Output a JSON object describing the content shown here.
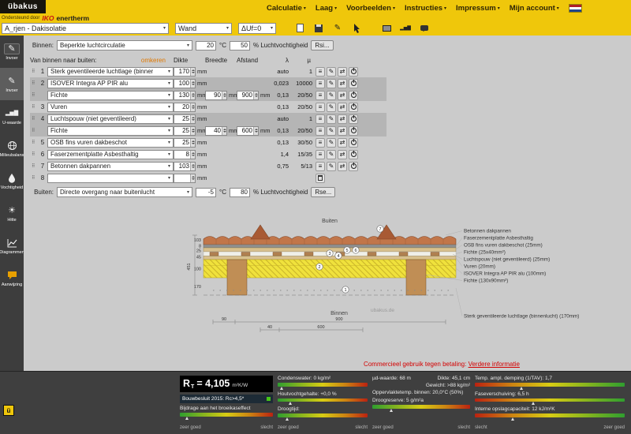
{
  "topbar": {
    "logo": "übakus",
    "supported_by": "Ondersteund door",
    "iko": "IKO",
    "enertherm": "enertherm",
    "menu": [
      "Calculatie",
      "Laag",
      "Voorbeelden",
      "Instructies",
      "Impressum",
      "Mijn account"
    ]
  },
  "toolbar": {
    "project": "A_rjen - Dakisolatie",
    "type": "Wand",
    "du": "ΔUf=0"
  },
  "icons": {
    "caret": "▾",
    "drag": "⠿",
    "menu": "≡",
    "edit": "✎",
    "swap": "⇄",
    "pencil": "✎",
    "sun": "☀",
    "bars": "▂▅▇"
  },
  "sidebar": [
    {
      "label": "Invoer"
    },
    {
      "label": "Invoer"
    },
    {
      "label": "U-waarde"
    },
    {
      "label": "Milieubalans"
    },
    {
      "label": "Vochtigheid"
    },
    {
      "label": "Hitte"
    },
    {
      "label": "Diagrammen"
    },
    {
      "label": "Aanwijzing"
    }
  ],
  "layers": {
    "binnen_label": "Binnen:",
    "binnen_condition": "Beperkte luchtcirculatie",
    "binnen_temp": "20",
    "deg": "°C",
    "binnen_rh": "50",
    "rh_label": "% Luchtvochtigheid",
    "rsi_button": "Rsi...",
    "buiten_label": "Buiten:",
    "buiten_condition": "Directe overgang naar buitenlucht",
    "buiten_temp": "-5",
    "buiten_rh": "80",
    "rse_button": "Rse...",
    "mm": "mm",
    "header": {
      "left": "Van binnen naar buiten:",
      "omkeren": "omkeren",
      "dikte": "Dikte",
      "breedte": "Breedte",
      "afstand": "Afstand",
      "lambda": "λ",
      "mu": "µ"
    },
    "rows": [
      {
        "num": "1",
        "material": "Sterk geventileerde luchtlage (binner",
        "dikte": "170",
        "lambda": "auto",
        "mu": "1"
      },
      {
        "num": "2",
        "material": "ISOVER Integra AP PIR alu",
        "dikte": "100",
        "lambda": "0,023",
        "mu": "10000"
      },
      {
        "num": "",
        "material": "Fichte",
        "dikte": "130",
        "breedte": "90",
        "afstand": "900",
        "lambda": "0,13",
        "mu": "20/50"
      },
      {
        "num": "3",
        "material": "Vuren",
        "dikte": "20",
        "lambda": "0,13",
        "mu": "20/50"
      },
      {
        "num": "4",
        "material": "Luchtspouw (niet geventileerd)",
        "dikte": "25",
        "lambda": "auto",
        "mu": "1"
      },
      {
        "num": "",
        "material": "Fichte",
        "dikte": "25",
        "breedte": "40",
        "afstand": "600",
        "lambda": "0,13",
        "mu": "20/50"
      },
      {
        "num": "5",
        "material": "OSB fins vuren dakbeschot",
        "dikte": "25",
        "lambda": "0,13",
        "mu": "30/50"
      },
      {
        "num": "6",
        "material": "Faserzementplatte Asbesthaltig",
        "dikte": "8",
        "lambda": "1,4",
        "mu": "15/35"
      },
      {
        "num": "7",
        "material": "Betonnen dakpannen",
        "dikte": "103",
        "lambda": "0,75",
        "mu": "5/13"
      },
      {
        "num": "8",
        "material": "",
        "dikte": "",
        "lambda": "",
        "mu": ""
      }
    ]
  },
  "diagram": {
    "buiten": "Buiten",
    "binnen": "Binnen",
    "watermark": "ubakus.de",
    "dims_left": [
      "103",
      "8",
      "25",
      "45",
      "100",
      "170"
    ],
    "dim_total": "451",
    "dim_90": "90",
    "dim_900": "900",
    "dim_40": "40",
    "dim_600": "600",
    "markers": [
      "1",
      "2",
      "3",
      "4",
      "5",
      "6",
      "7"
    ],
    "labels": [
      "Betonnen dakpannen",
      "Faserzementplatte Asbesthaltig",
      "OSB fins vuren dakbeschot (25mm)",
      "Fichte (25x40mm²)",
      "Luchtspouw (niet geventileerd) (25mm)",
      "Vuren (20mm)",
      "ISOVER Integra AP PIR alu (100mm)",
      "Fichte (130x90mm²)",
      "Sterk geventileerde luchtlage (binnenlucht) (170mm)"
    ]
  },
  "notice": {
    "text": "Commercieel gebruik tegen betaling:",
    "link": "Verdere informatie"
  },
  "footer": {
    "rt_r": "R",
    "rt_sub": "T",
    "rt_eq": "= 4,105",
    "rt_unit": "m²K/W",
    "bouwbesluit": "Bouwbesluit 2015: Rc>4,5*",
    "broeikas": "Bijdrage aan het broeikaseffect",
    "condenswater": "Condenswater: 0 kg/m²",
    "houtvocht": "Houtvochtgehalte: +0,0 %",
    "droogtijd": "Droogtijd:",
    "mud": "µd-waarde: 68 m",
    "dikte": "Dikte: 45,1 cm",
    "gewicht": "Gewicht: >88 kg/m²",
    "oppervlakte": "Oppervlaktetemp. binnen: 20,0°C (50%)",
    "droogreserve": "Droogreserve: 5 g/m²a",
    "tav": "Temp. ampl. demping (1/TAV): 1,7",
    "fase": "Faseverschuiving: 6,5 h",
    "opslag": "Interne opslagcapaciteit: 12 kJ/m²K",
    "zeer_goed": "zeer goed",
    "slecht": "slecht"
  }
}
